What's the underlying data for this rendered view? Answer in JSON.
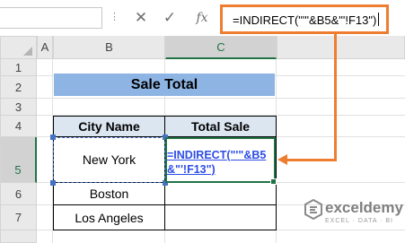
{
  "formula_bar": {
    "cancel_icon": "cross-icon",
    "enter_icon": "check-icon",
    "function_icon": "fx",
    "formula": "=INDIRECT(\"'\"&B5&\"'!F13\")"
  },
  "columns": [
    "A",
    "B",
    "C"
  ],
  "rows": [
    "1",
    "2",
    "3",
    "4",
    "5",
    "6",
    "7"
  ],
  "title": "Sale Total",
  "table": {
    "headers": [
      "City Name",
      "Total Sale"
    ],
    "cities": [
      "New York",
      "Boston",
      "Los Angeles"
    ],
    "active_cell_formula_line1": "=INDIRECT(\"'\"&B5",
    "active_cell_formula_line2": "&\"'!F13\")"
  },
  "watermark": {
    "name": "exceldemy",
    "tagline": "EXCEL · DATA · BI"
  },
  "colors": {
    "accent_orange": "#ed7d31",
    "title_fill": "#8eb4e3",
    "header_fill": "#dce6f1",
    "selection_green": "#217346"
  }
}
